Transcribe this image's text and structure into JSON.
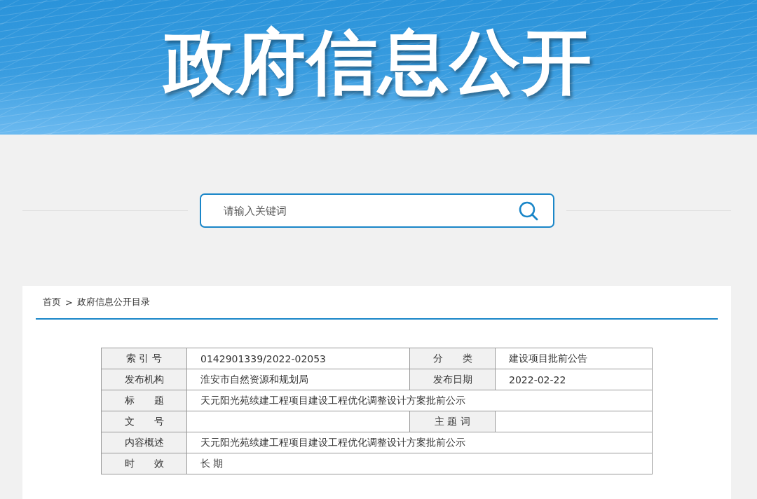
{
  "banner": {
    "title": "政府信息公开"
  },
  "search": {
    "placeholder": "请输入关键词"
  },
  "breadcrumb": [
    {
      "label": "首页"
    },
    {
      "label": "政府信息公开目录"
    }
  ],
  "breadcrumb_separator": ">",
  "info_table": {
    "rows": [
      {
        "cells": [
          {
            "label": "索 引 号",
            "value": "0142901339/2022-02053"
          },
          {
            "label": "分　　类",
            "value": "建设项目批前公告"
          }
        ]
      },
      {
        "cells": [
          {
            "label": "发布机构",
            "value": "淮安市自然资源和规划局"
          },
          {
            "label": "发布日期",
            "value": "2022-02-22"
          }
        ]
      },
      {
        "cells": [
          {
            "label": "标　　题",
            "value": "天元阳光苑续建工程项目建设工程优化调整设计方案批前公示"
          }
        ]
      },
      {
        "cells": [
          {
            "label": "文　　号"
          },
          {
            "label": "主 题 词"
          }
        ]
      },
      {
        "cells": [
          {
            "label": "内容概述",
            "value": "天元阳光苑续建工程项目建设工程优化调整设计方案批前公示"
          }
        ]
      },
      {
        "cells": [
          {
            "label": "时　　效",
            "value": "长 期"
          }
        ]
      }
    ]
  }
}
